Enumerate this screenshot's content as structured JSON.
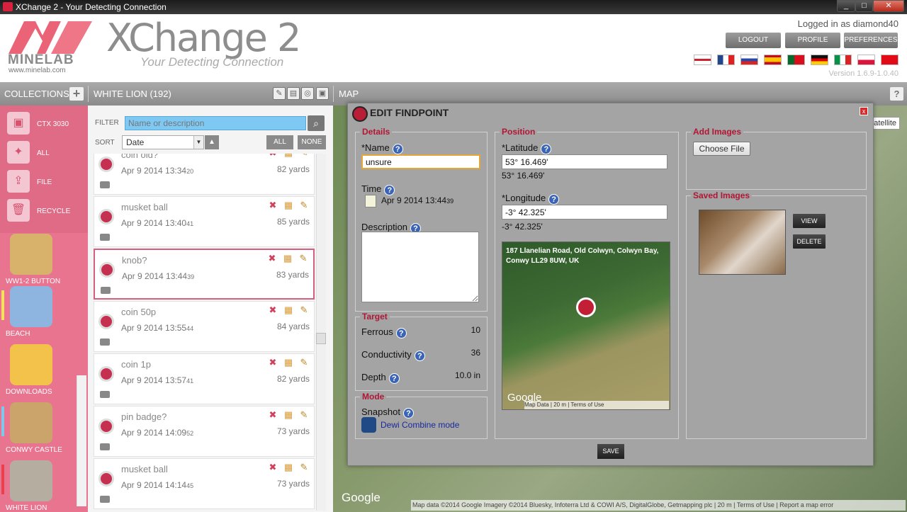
{
  "window": {
    "title": "XChange 2 - Your Detecting Connection",
    "min": "_",
    "max": "□",
    "close": "✕"
  },
  "header": {
    "logo_text": "MINELAB",
    "logo_url": "www.minelab.com",
    "app_title": "XChange 2",
    "tagline": "Your Detecting Connection",
    "logged_in": "Logged in as diamond40",
    "buttons": {
      "logout": "LOGOUT",
      "profile": "PROFILE",
      "preferences": "PREFERENCES"
    },
    "version": "Version 1.6.9-1.0.40",
    "flags": [
      "english-flag",
      "french-flag",
      "russian-flag",
      "spanish-flag",
      "portuguese-flag",
      "german-flag",
      "italian-flag",
      "polish-flag",
      "turkish-flag"
    ]
  },
  "toolbar": {
    "collections": "COLLECTIONS",
    "add": "+",
    "collection_name": "WHITE LION (192)",
    "map": "MAP",
    "help": "?"
  },
  "sidebar": {
    "items": [
      {
        "label": "CTX 3030",
        "icon": "device-icon",
        "glyph": "▣"
      },
      {
        "label": "ALL",
        "icon": "all-icon",
        "glyph": "✦"
      },
      {
        "label": "FILE",
        "icon": "file-icon",
        "glyph": "⇪"
      },
      {
        "label": "RECYCLE",
        "icon": "recycle-icon",
        "glyph": "🗑"
      }
    ],
    "collections": [
      {
        "label": "WW1-2 BUTTON",
        "color": "#d8b26a"
      },
      {
        "label": "BEACH",
        "color": "#8eb5e0",
        "bar": "#f6e05c"
      },
      {
        "label": "DOWNLOADS",
        "color": "#f2c24b"
      },
      {
        "label": "CONWY CASTLE",
        "color": "#caa46a",
        "bar": "#7ec8ea"
      },
      {
        "label": "WHITE LION",
        "color": "#b5ada0",
        "bar": "#e8404c"
      }
    ]
  },
  "list": {
    "filter_label": "FILTER",
    "filter_placeholder": "Name or description",
    "sort_label": "SORT",
    "sort_value": "Date",
    "all": "ALL",
    "none": "NONE",
    "rows": [
      {
        "name": "coin old?",
        "date": "Apr 9 2014  13:34",
        "sec": "20",
        "dist": "82 yards"
      },
      {
        "name": "musket ball",
        "date": "Apr 9 2014  13:40",
        "sec": "41",
        "dist": "85 yards"
      },
      {
        "name": "knob?",
        "date": "Apr 9 2014  13:44",
        "sec": "39",
        "dist": "83 yards"
      },
      {
        "name": "coin 50p",
        "date": "Apr 9 2014  13:55",
        "sec": "44",
        "dist": "84 yards"
      },
      {
        "name": "coin 1p",
        "date": "Apr 9 2014  13:57",
        "sec": "41",
        "dist": "82 yards"
      },
      {
        "name": "pin badge?",
        "date": "Apr 9 2014  14:09",
        "sec": "52",
        "dist": "73 yards"
      },
      {
        "name": "musket ball",
        "date": "Apr 9 2014  14:14",
        "sec": "45",
        "dist": "73 yards"
      }
    ]
  },
  "map": {
    "satellite": "atellite",
    "google": "Google",
    "footer": "Map data ©2014 Google Imagery ©2014 Bluesky, Infoterra Ltd & COWI A/S, DigitalGlobe, Getmapping plc  |  20 m  |  Terms of Use  |  Report a map error"
  },
  "modal": {
    "title": "EDIT FINDPOINT",
    "close": "x",
    "details": {
      "title": "Details",
      "name_label": "*Name",
      "name_value": "unsure",
      "time_label": "Time",
      "time_value": "Apr 9 2014  13:44",
      "time_sec": "39",
      "desc_label": "Description"
    },
    "target": {
      "title": "Target",
      "ferrous_label": "Ferrous",
      "ferrous_value": "10",
      "conductivity_label": "Conductivity",
      "conductivity_value": "36",
      "depth_label": "Depth",
      "depth_value": "10.0 in"
    },
    "mode": {
      "title": "Mode",
      "snapshot_label": "Snapshot",
      "mode_value": "Dewi Combine mode"
    },
    "position": {
      "title": "Position",
      "lat_label": "*Latitude",
      "lat_value": "53° 16.469'",
      "lat_display": "53° 16.469'",
      "lon_label": "*Longitude",
      "lon_value": "-3° 42.325'",
      "lon_display": "-3° 42.325'",
      "address": "187 Llanelian Road, Old Colwyn, Colwyn Bay, Conwy LL29 8UW, UK",
      "google": "Google",
      "map_footer": "Map Data  |  20 m  |  Terms of Use"
    },
    "add_images": {
      "title": "Add Images",
      "button": "Choose File"
    },
    "saved_images": {
      "title": "Saved Images",
      "view": "VIEW",
      "delete": "DELETE"
    },
    "save": "SAVE",
    "help": "?"
  }
}
